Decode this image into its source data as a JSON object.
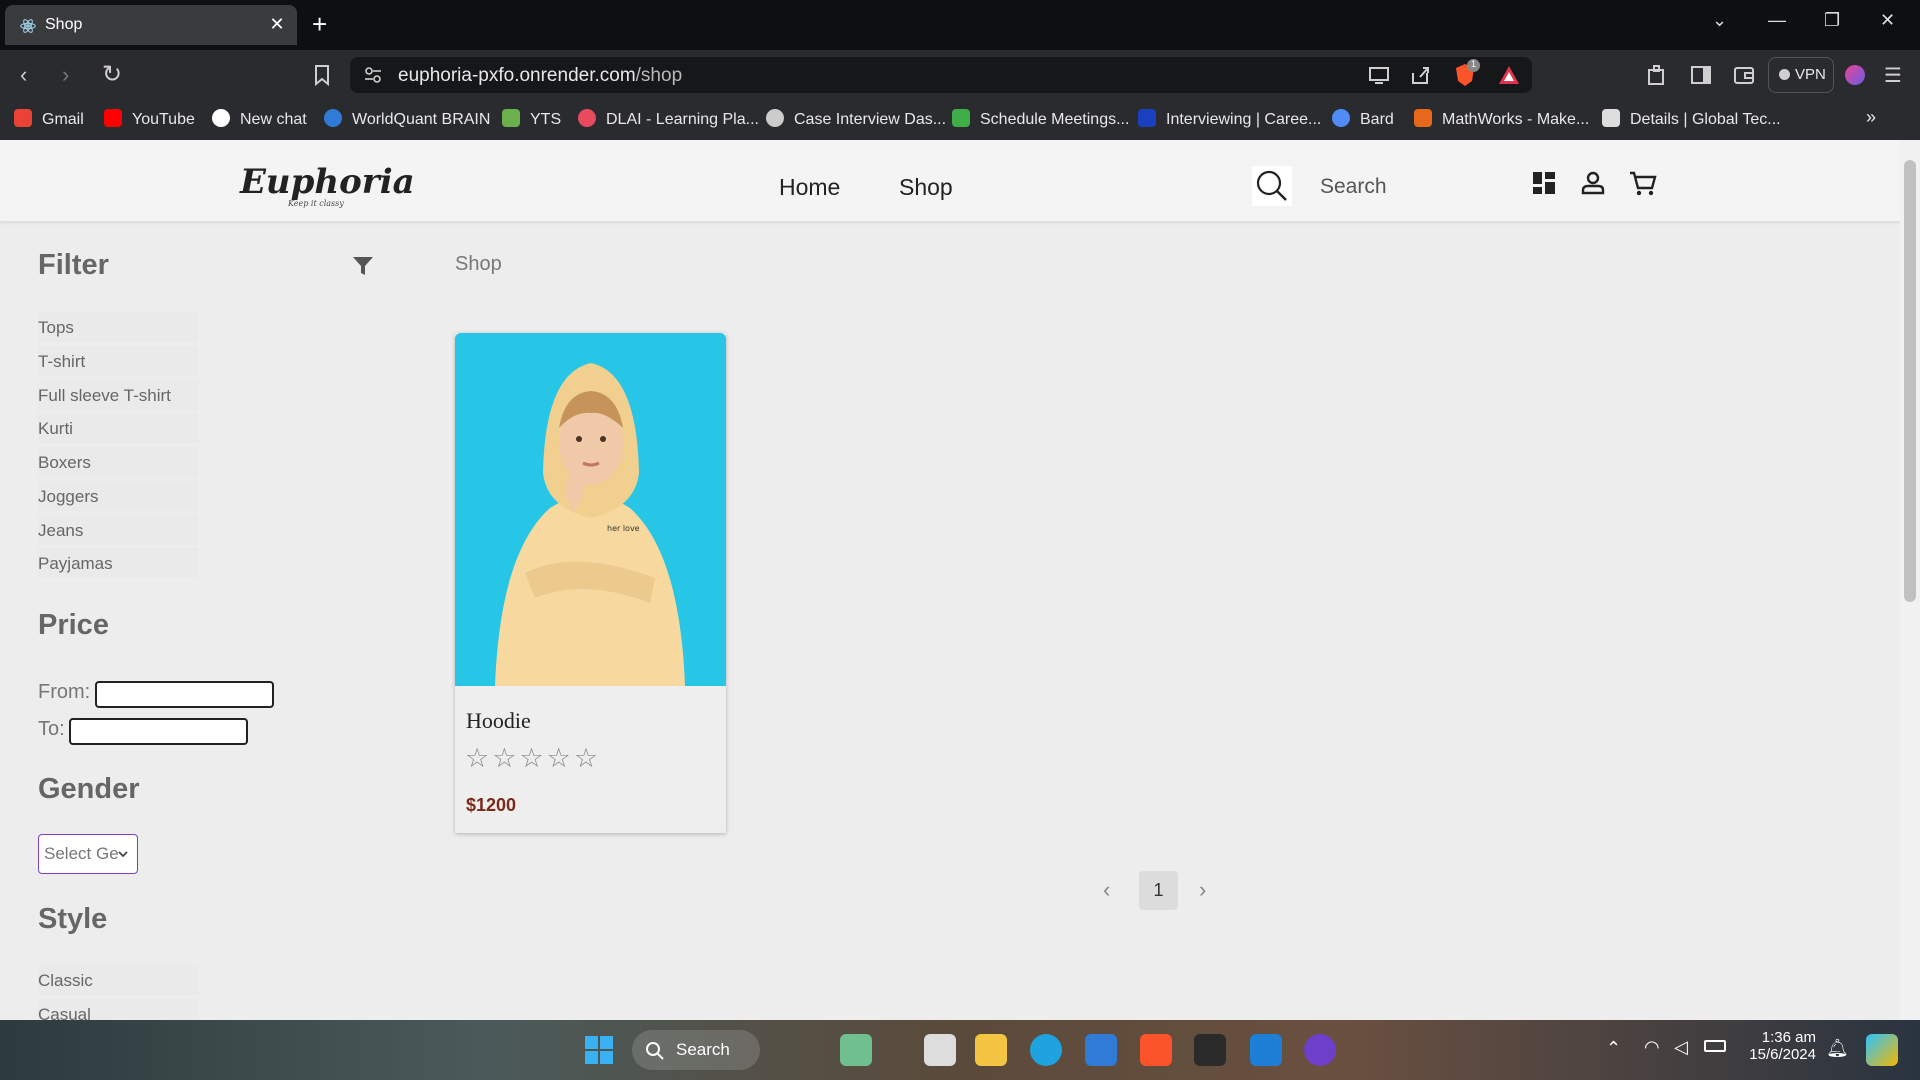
{
  "browser": {
    "tab_title": "Shop",
    "tab_close": "✕",
    "new_tab": "+",
    "url_domain": "euphoria-pxfo.onrender.com",
    "url_path": "/shop",
    "vpn_label": "VPN",
    "shield_count": "1",
    "bookmarks": [
      {
        "label": "Gmail",
        "color": "#ea4335"
      },
      {
        "label": "YouTube",
        "color": "#ff0000"
      },
      {
        "label": "New chat",
        "color": "#ffffff"
      },
      {
        "label": "WorldQuant BRAIN",
        "color": "#2f7bd6"
      },
      {
        "label": "YTS",
        "color": "#6ab04c"
      },
      {
        "label": "DLAI - Learning Pla...",
        "color": "#e84a5f"
      },
      {
        "label": "Case Interview Das...",
        "color": "#cccccc"
      },
      {
        "label": "Schedule Meetings...",
        "color": "#3fae49"
      },
      {
        "label": "Interviewing | Caree...",
        "color": "#1a3fbf"
      },
      {
        "label": "Bard",
        "color": "#4f8cf7"
      },
      {
        "label": "MathWorks - Make...",
        "color": "#e8681b"
      },
      {
        "label": "Details | Global Tec...",
        "color": "#dddddd"
      }
    ]
  },
  "site": {
    "logo": "Euphoria",
    "logo_tagline": "Keep it classy",
    "nav": {
      "home": "Home",
      "shop": "Shop"
    },
    "search_placeholder": "Search"
  },
  "sidebar": {
    "filter_title": "Filter",
    "categories": [
      "Tops",
      "T-shirt",
      "Full sleeve T-shirt",
      "Kurti",
      "Boxers",
      "Joggers",
      "Jeans",
      "Payjamas"
    ],
    "price_title": "Price",
    "price_from_label": "From:",
    "price_to_label": "To:",
    "price_from_value": "",
    "price_to_value": "",
    "gender_title": "Gender",
    "gender_select_value": "Select Ge",
    "style_title": "Style",
    "styles": [
      "Classic",
      "Casual"
    ]
  },
  "main": {
    "breadcrumb": "Shop",
    "products": [
      {
        "name": "Hoodie",
        "rating": 0,
        "rating_max": 5,
        "price": "$1200",
        "image_bg": "#28c6e6",
        "hoodie_color": "#f7d9a0"
      }
    ],
    "pagination": {
      "prev": "‹",
      "current": "1",
      "next": "›"
    }
  },
  "taskbar": {
    "search_label": "Search",
    "time": "1:36 am",
    "date": "15/6/2024"
  }
}
